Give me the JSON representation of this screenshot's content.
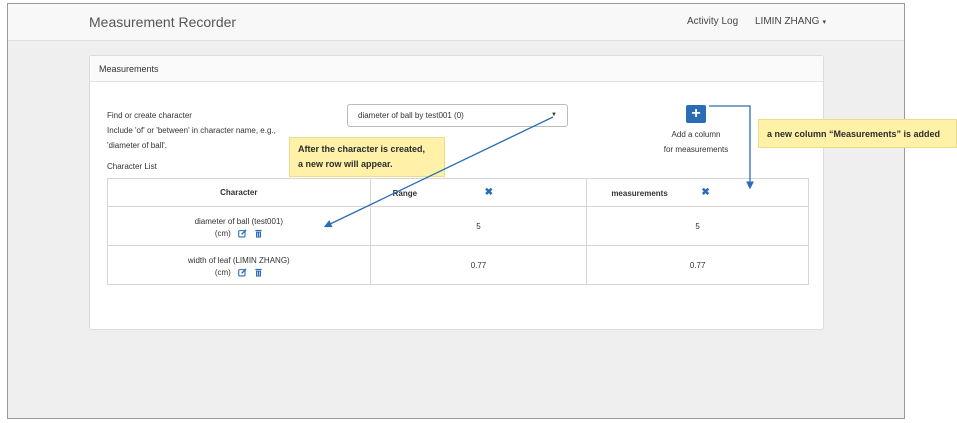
{
  "app": {
    "title": "Measurement Recorder"
  },
  "nav": {
    "activity_log": "Activity Log",
    "user": "LIMIN ZHANG",
    "user_caret": "▾"
  },
  "panel": {
    "heading": "Measurements",
    "find_label_lines": [
      "Find or create character",
      "Include 'of' or 'between' in character name, e.g.,",
      "'diameter of ball'."
    ],
    "select_value": "diameter of ball by test001 (0)",
    "add_column_icon": "plus-icon",
    "add_column_label_lines": [
      "Add a column",
      "for measurements"
    ],
    "list_label": "Character List"
  },
  "table": {
    "headers": {
      "character": "Character",
      "range": "Range",
      "measurements": "measurements"
    },
    "rows": [
      {
        "name": "diameter of ball (test001)",
        "unit": "(cm)",
        "range": "5",
        "measurements": "5"
      },
      {
        "name": "width of leaf (LIMIN ZHANG)",
        "unit": "(cm)",
        "range": "0.77",
        "measurements": "0.77"
      }
    ]
  },
  "annotations": {
    "row_tip_lines": [
      "After the character is created,",
      "a new row will appear."
    ],
    "column_tip": "a new column “Measurements” is added"
  },
  "colors": {
    "accent": "#2a6cb5",
    "tooltip_bg": "#fff2a8",
    "navbar_bg": "#f8f8f8",
    "page_bg": "#efefef"
  }
}
